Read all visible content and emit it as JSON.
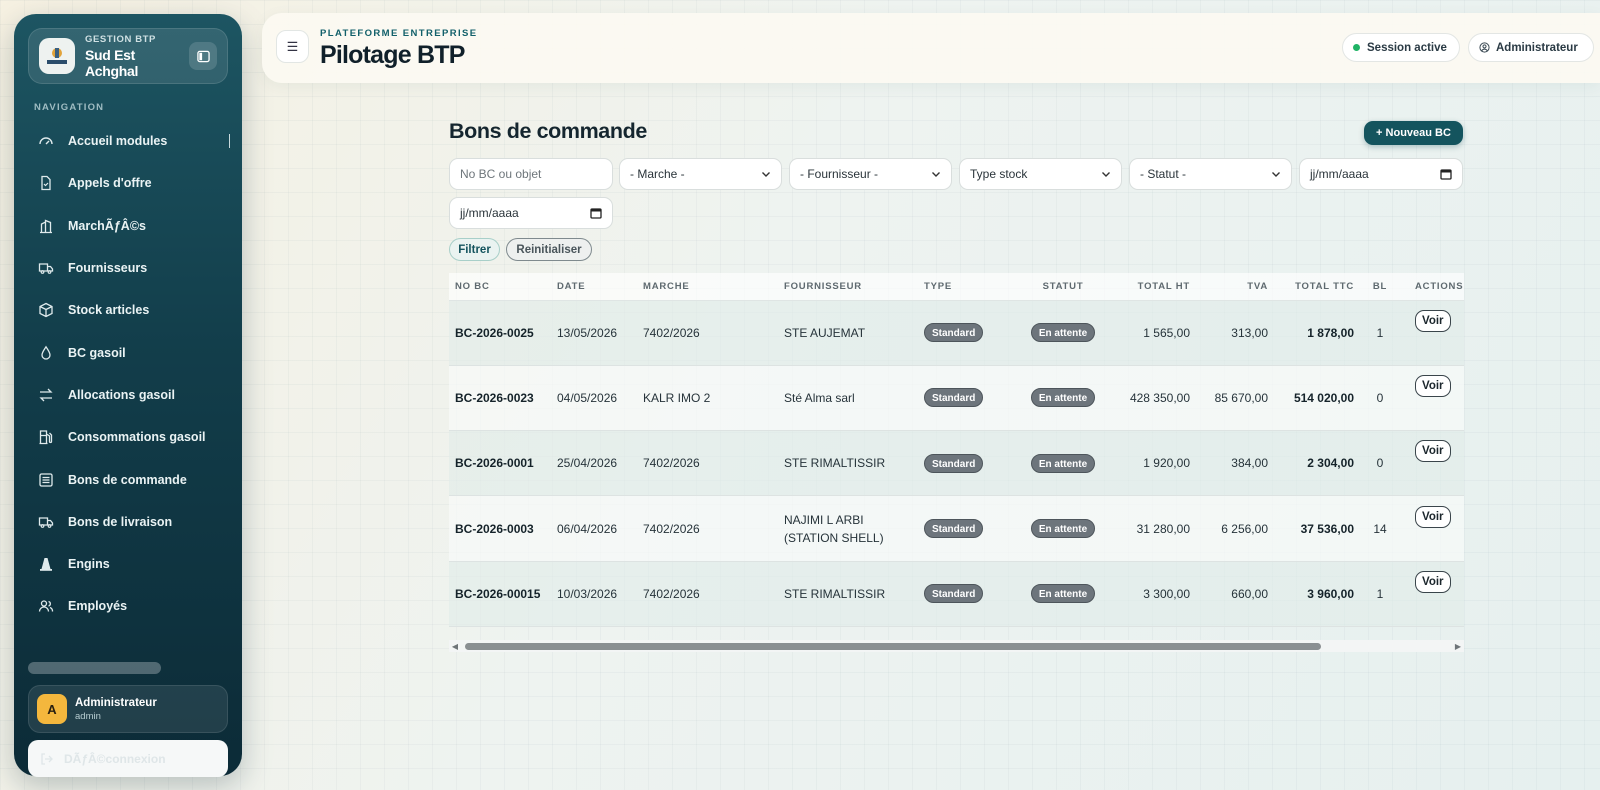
{
  "brand": {
    "subtitle": "GESTION BTP",
    "name": "Sud Est Achghal"
  },
  "nav": {
    "title": "NAVIGATION",
    "items": [
      {
        "label": "Accueil modules",
        "icon": "gauge-icon"
      },
      {
        "label": "Appels d'offre",
        "icon": "document-icon"
      },
      {
        "label": "MarchÃƒÂ©s",
        "icon": "building-icon"
      },
      {
        "label": "Fournisseurs",
        "icon": "truck-icon"
      },
      {
        "label": "Stock articles",
        "icon": "box-icon"
      },
      {
        "label": "BC gasoil",
        "icon": "droplet-icon"
      },
      {
        "label": "Allocations gasoil",
        "icon": "arrows-icon"
      },
      {
        "label": "Consommations gasoil",
        "icon": "fuel-pump-icon"
      },
      {
        "label": "Bons de commande",
        "icon": "list-icon"
      },
      {
        "label": "Bons de livraison",
        "icon": "truck-icon"
      },
      {
        "label": "Engins",
        "icon": "cone-icon"
      },
      {
        "label": "Employés",
        "icon": "users-icon"
      }
    ]
  },
  "user": {
    "initial": "A",
    "name": "Administrateur",
    "login": "admin"
  },
  "logout_label": "DÃƒÂ©connexion",
  "header": {
    "eyebrow": "PLATEFORME ENTREPRISE",
    "title": "Pilotage BTP",
    "session_label": "Session active",
    "admin_label": "Administrateur"
  },
  "content": {
    "title": "Bons de commande",
    "new_button": "+ Nouveau BC",
    "filters": {
      "search_placeholder": "No BC ou objet",
      "marche": "- Marche -",
      "fournisseur": "- Fournisseur -",
      "type_stock": "Type stock",
      "statut": "- Statut -",
      "date_from": "jj/mm/aaaa",
      "date_to": "jj/mm/aaaa",
      "filter_button": "Filtrer",
      "reset_button": "Reinitialiser"
    }
  },
  "table": {
    "columns": [
      "NO BC",
      "DATE",
      "MARCHE",
      "FOURNISSEUR",
      "TYPE",
      "STATUT",
      "TOTAL HT",
      "TVA",
      "TOTAL TTC",
      "BL",
      "ACTIONS"
    ],
    "view_label": "Voir",
    "rows": [
      {
        "no": "BC-2026-0025",
        "date": "13/05/2026",
        "marche": "7402/2026",
        "fournisseur": "STE AUJEMAT",
        "type": "Standard",
        "statut": "En attente",
        "ht": "1 565,00",
        "tva": "313,00",
        "ttc": "1 878,00",
        "bl": "1"
      },
      {
        "no": "BC-2026-0023",
        "date": "04/05/2026",
        "marche": "KALR IMO 2",
        "fournisseur": "Sté Alma sarl",
        "type": "Standard",
        "statut": "En attente",
        "ht": "428 350,00",
        "tva": "85 670,00",
        "ttc": "514 020,00",
        "bl": "0"
      },
      {
        "no": "BC-2026-0001",
        "date": "25/04/2026",
        "marche": "7402/2026",
        "fournisseur": "STE RIMALTISSIR",
        "type": "Standard",
        "statut": "En attente",
        "ht": "1 920,00",
        "tva": "384,00",
        "ttc": "2 304,00",
        "bl": "0"
      },
      {
        "no": "BC-2026-0003",
        "date": "06/04/2026",
        "marche": "7402/2026",
        "fournisseur": "NAJIMI L ARBI (STATION SHELL)",
        "type": "Standard",
        "statut": "En attente",
        "ht": "31 280,00",
        "tva": "6 256,00",
        "ttc": "37 536,00",
        "bl": "14"
      },
      {
        "no": "BC-2026-00015",
        "date": "10/03/2026",
        "marche": "7402/2026",
        "fournisseur": "STE RIMALTISSIR",
        "type": "Standard",
        "statut": "En attente",
        "ht": "3 300,00",
        "tva": "660,00",
        "ttc": "3 960,00",
        "bl": "1"
      }
    ]
  },
  "colors": {
    "sidebar": "#123d4a",
    "accent": "#14545e",
    "badge": "#6d757c",
    "avatar": "#f4b73d",
    "session_dot": "#1fb365"
  }
}
